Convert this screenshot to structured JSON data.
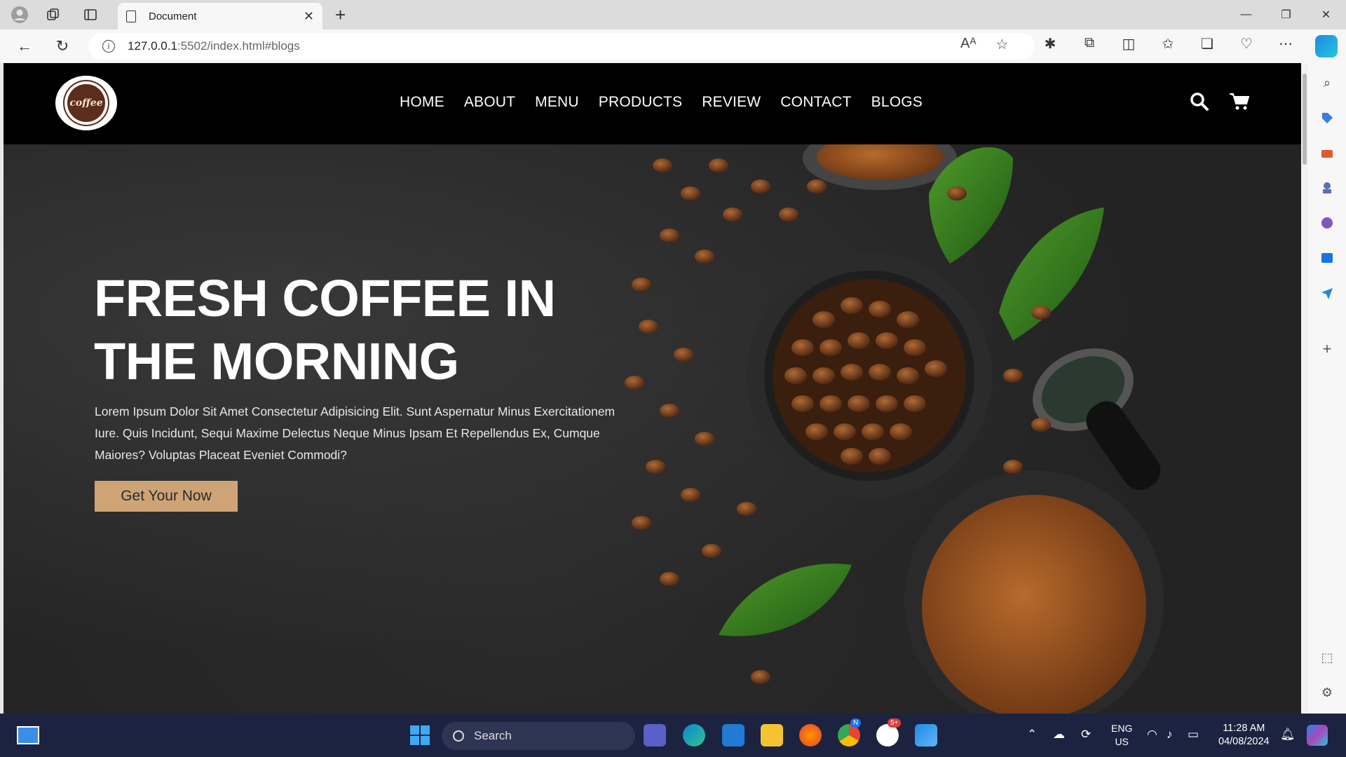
{
  "browser": {
    "tab_title": "Document",
    "url_host": "127.0.0.1",
    "url_rest": ":5502/index.html#blogs"
  },
  "site": {
    "logo_text": "coffee",
    "nav": [
      "HOME",
      "ABOUT",
      "MENU",
      "PRODUCTS",
      "REVIEW",
      "CONTACT",
      "BLOGS"
    ],
    "hero_title_line1": "FRESH COFFEE IN",
    "hero_title_line2": "THE MORNING",
    "hero_text": "Lorem Ipsum Dolor Sit Amet Consectetur Adipisicing Elit. Sunt Aspernatur Minus Exercitationem Iure. Quis Incidunt, Sequi Maxime Delectus Neque Minus Ipsam Et Repellendus Ex, Cumque Maiores? Voluptas Placeat Eveniet Commodi?",
    "hero_button": "Get Your Now",
    "accent_color": "#cea477"
  },
  "taskbar": {
    "search_label": "Search",
    "lang_line1": "ENG",
    "lang_line2": "US",
    "time": "11:28 AM",
    "date": "04/08/2024",
    "zoom_badge": "5+",
    "chrome_badge": "N"
  }
}
